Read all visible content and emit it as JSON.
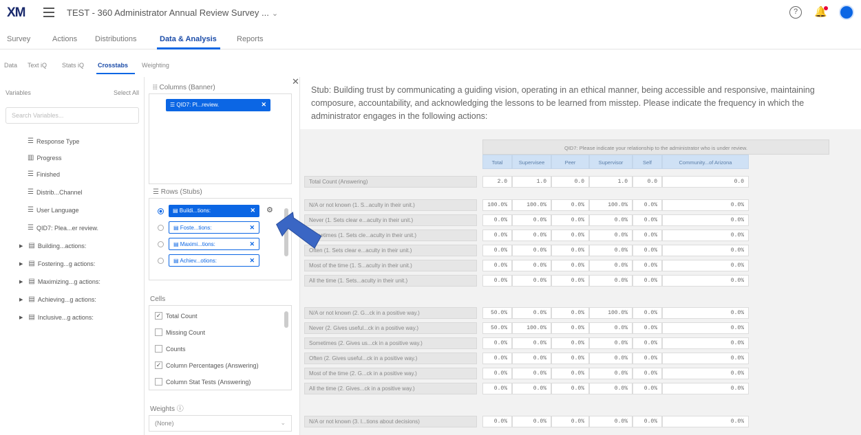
{
  "header": {
    "logo": "XM",
    "survey_title": "TEST - 360 Administrator Annual Review Survey ...",
    "caret": "⌄",
    "help_glyph": "?",
    "bell_glyph": "🔔"
  },
  "nav": {
    "tabs": [
      "Survey",
      "Actions",
      "Distributions",
      "Data & Analysis",
      "Reports"
    ],
    "active": "Data & Analysis"
  },
  "subnav": {
    "tabs": [
      "Data",
      "Text iQ",
      "Stats iQ",
      "Crosstabs",
      "Weighting"
    ],
    "active": "Crosstabs"
  },
  "variables": {
    "title": "Variables",
    "select_all": "Select All",
    "search_placeholder": "Search Variables...",
    "items": [
      {
        "label": "Response Type",
        "icon": "list-icon"
      },
      {
        "label": "Progress",
        "icon": "bar-chart-icon"
      },
      {
        "label": "Finished",
        "icon": "list-icon"
      },
      {
        "label": "Distrib...Channel",
        "icon": "list-icon"
      },
      {
        "label": "User Language",
        "icon": "list-icon"
      },
      {
        "label": "QID7: Plea...er review.",
        "icon": "list-icon"
      },
      {
        "label": "Building...actions:",
        "icon": "matrix-icon"
      },
      {
        "label": "Fostering...g actions:",
        "icon": "matrix-icon"
      },
      {
        "label": "Maximizing...g actions:",
        "icon": "matrix-icon"
      },
      {
        "label": "Achieving...g actions:",
        "icon": "matrix-icon"
      },
      {
        "label": "Inclusive...g actions:",
        "icon": "matrix-icon"
      }
    ]
  },
  "columns_panel": {
    "title": "Columns (Banner)",
    "chip": "QID7: Pl...review."
  },
  "rows_panel": {
    "title": "Rows (Stubs)",
    "chips": [
      "Buildi...tions:",
      "Foste...tions:",
      "Maximi...tions:",
      "Achiev...otions:"
    ]
  },
  "cells_panel": {
    "title": "Cells",
    "options": [
      {
        "label": "Total Count",
        "checked": true
      },
      {
        "label": "Missing Count",
        "checked": false
      },
      {
        "label": "Counts",
        "checked": false
      },
      {
        "label": "Column Percentages (Answering)",
        "checked": true
      },
      {
        "label": "Column Stat Tests (Answering)",
        "checked": false
      }
    ]
  },
  "weights": {
    "title": "Weights",
    "info_glyph": "ⓘ",
    "value": "(None)"
  },
  "stub_text": "Stub: Building trust by communicating a guiding vision, operating in an ethical manner, being accessible and responsive, maintaining composure, accountability, and acknowledging the lessons to be learned from misstep. Please indicate the frequency in which the administrator engages in the following actions:",
  "table": {
    "banner_title": "QID7: Please indicate your relationship to the administrator who is under review.",
    "columns": [
      "Total",
      "Supervisee",
      "Peer",
      "Supervisor",
      "Self",
      "Community...of Arizona"
    ],
    "total_row": {
      "label": "Total Count (Answering)",
      "values": [
        "2.0",
        "1.0",
        "0.0",
        "1.0",
        "0.0",
        "0.0"
      ]
    },
    "block1": [
      {
        "label": "N/A or not known (1. S...aculty in their unit.)",
        "values": [
          "100.0%",
          "100.0%",
          "0.0%",
          "100.0%",
          "0.0%",
          "0.0%"
        ]
      },
      {
        "label": "Never (1. Sets clear e...aculty in their unit.)",
        "values": [
          "0.0%",
          "0.0%",
          "0.0%",
          "0.0%",
          "0.0%",
          "0.0%"
        ]
      },
      {
        "label": "Sometimes (1. Sets cle...aculty in their unit.)",
        "values": [
          "0.0%",
          "0.0%",
          "0.0%",
          "0.0%",
          "0.0%",
          "0.0%"
        ]
      },
      {
        "label": "Often (1. Sets clear e...aculty in their unit.)",
        "values": [
          "0.0%",
          "0.0%",
          "0.0%",
          "0.0%",
          "0.0%",
          "0.0%"
        ]
      },
      {
        "label": "Most of the time (1. S...aculty in their unit.)",
        "values": [
          "0.0%",
          "0.0%",
          "0.0%",
          "0.0%",
          "0.0%",
          "0.0%"
        ]
      },
      {
        "label": "All the time (1. Sets...aculty in their unit.)",
        "values": [
          "0.0%",
          "0.0%",
          "0.0%",
          "0.0%",
          "0.0%",
          "0.0%"
        ]
      }
    ],
    "block2": [
      {
        "label": "N/A or not known (2. G...ck in a positive way.)",
        "values": [
          "50.0%",
          "0.0%",
          "0.0%",
          "100.0%",
          "0.0%",
          "0.0%"
        ]
      },
      {
        "label": "Never (2. Gives useful...ck in a positive way.)",
        "values": [
          "50.0%",
          "100.0%",
          "0.0%",
          "0.0%",
          "0.0%",
          "0.0%"
        ]
      },
      {
        "label": "Sometimes (2. Gives us...ck in a positive way.)",
        "values": [
          "0.0%",
          "0.0%",
          "0.0%",
          "0.0%",
          "0.0%",
          "0.0%"
        ]
      },
      {
        "label": "Often (2. Gives useful...ck in a positive way.)",
        "values": [
          "0.0%",
          "0.0%",
          "0.0%",
          "0.0%",
          "0.0%",
          "0.0%"
        ]
      },
      {
        "label": "Most of the time (2. G...ck in a positive way.)",
        "values": [
          "0.0%",
          "0.0%",
          "0.0%",
          "0.0%",
          "0.0%",
          "0.0%"
        ]
      },
      {
        "label": "All the time (2. Gives...ck in a positive way.)",
        "values": [
          "0.0%",
          "0.0%",
          "0.0%",
          "0.0%",
          "0.0%",
          "0.0%"
        ]
      }
    ],
    "block3": [
      {
        "label": "N/A or not known (3. I...tions about decisions)",
        "values": [
          "0.0%",
          "0.0%",
          "0.0%",
          "0.0%",
          "0.0%",
          "0.0%"
        ]
      }
    ]
  },
  "colors": {
    "accent": "#0b66e4",
    "logo": "#1a2a6c",
    "pointer": "#3a66c4"
  }
}
